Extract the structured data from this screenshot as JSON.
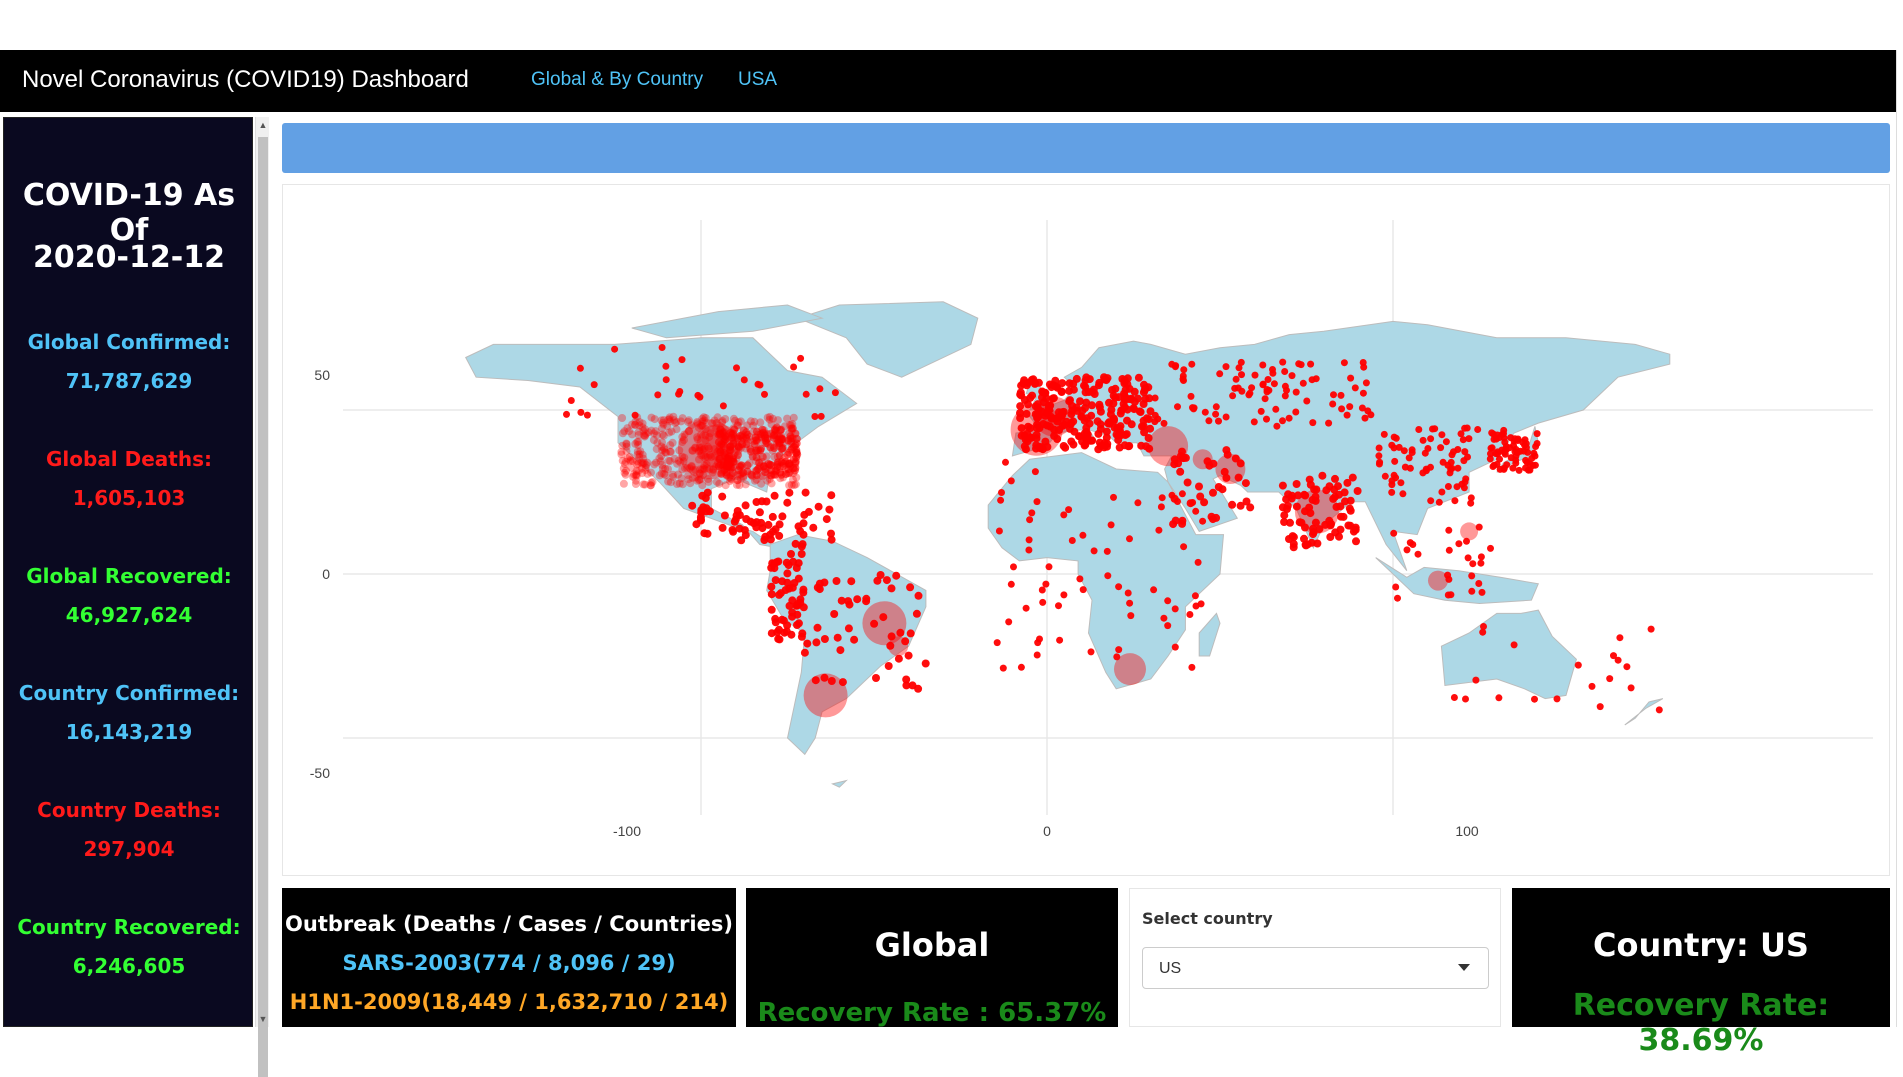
{
  "navbar": {
    "brand": "Novel Coronavirus (COVID19) Dashboard",
    "links": [
      "Global & By Country",
      "USA"
    ]
  },
  "sidebar": {
    "title_line1": "COVID-19 As Of",
    "title_line2": "2020-12-12",
    "stats": [
      {
        "label": "Global Confirmed:",
        "value": "71,787,629",
        "color": "#4fc3f7"
      },
      {
        "label": "Global Deaths:",
        "value": "1,605,103",
        "color": "#ff1a1a"
      },
      {
        "label": "Global Recovered:",
        "value": "46,927,624",
        "color": "#33ff33"
      },
      {
        "label": "Country Confirmed:",
        "value": "16,143,219",
        "color": "#4fc3f7"
      },
      {
        "label": "Country Deaths:",
        "value": "297,904",
        "color": "#ff1a1a"
      },
      {
        "label": "Country Recovered:",
        "value": "6,246,605",
        "color": "#33ff33"
      }
    ]
  },
  "map": {
    "y_ticks": [
      "50",
      "0",
      "-50"
    ],
    "x_ticks": [
      "-100",
      "0",
      "100"
    ],
    "marker_color": "#ff0000",
    "land_color": "#add8e6"
  },
  "outbreak": {
    "title": "Outbreak (Deaths / Cases / Countries)",
    "line1": "SARS-2003(774 / 8,096 / 29)",
    "line2": "H1N1-2009(18,449 / 1,632,710 / 214)"
  },
  "global_panel": {
    "title": "Global",
    "rate": "Recovery Rate : 65.37%"
  },
  "selector": {
    "label": "Select country",
    "value": "US"
  },
  "country_panel": {
    "title": "Country: US",
    "rate": "Recovery Rate: 38.69%"
  }
}
